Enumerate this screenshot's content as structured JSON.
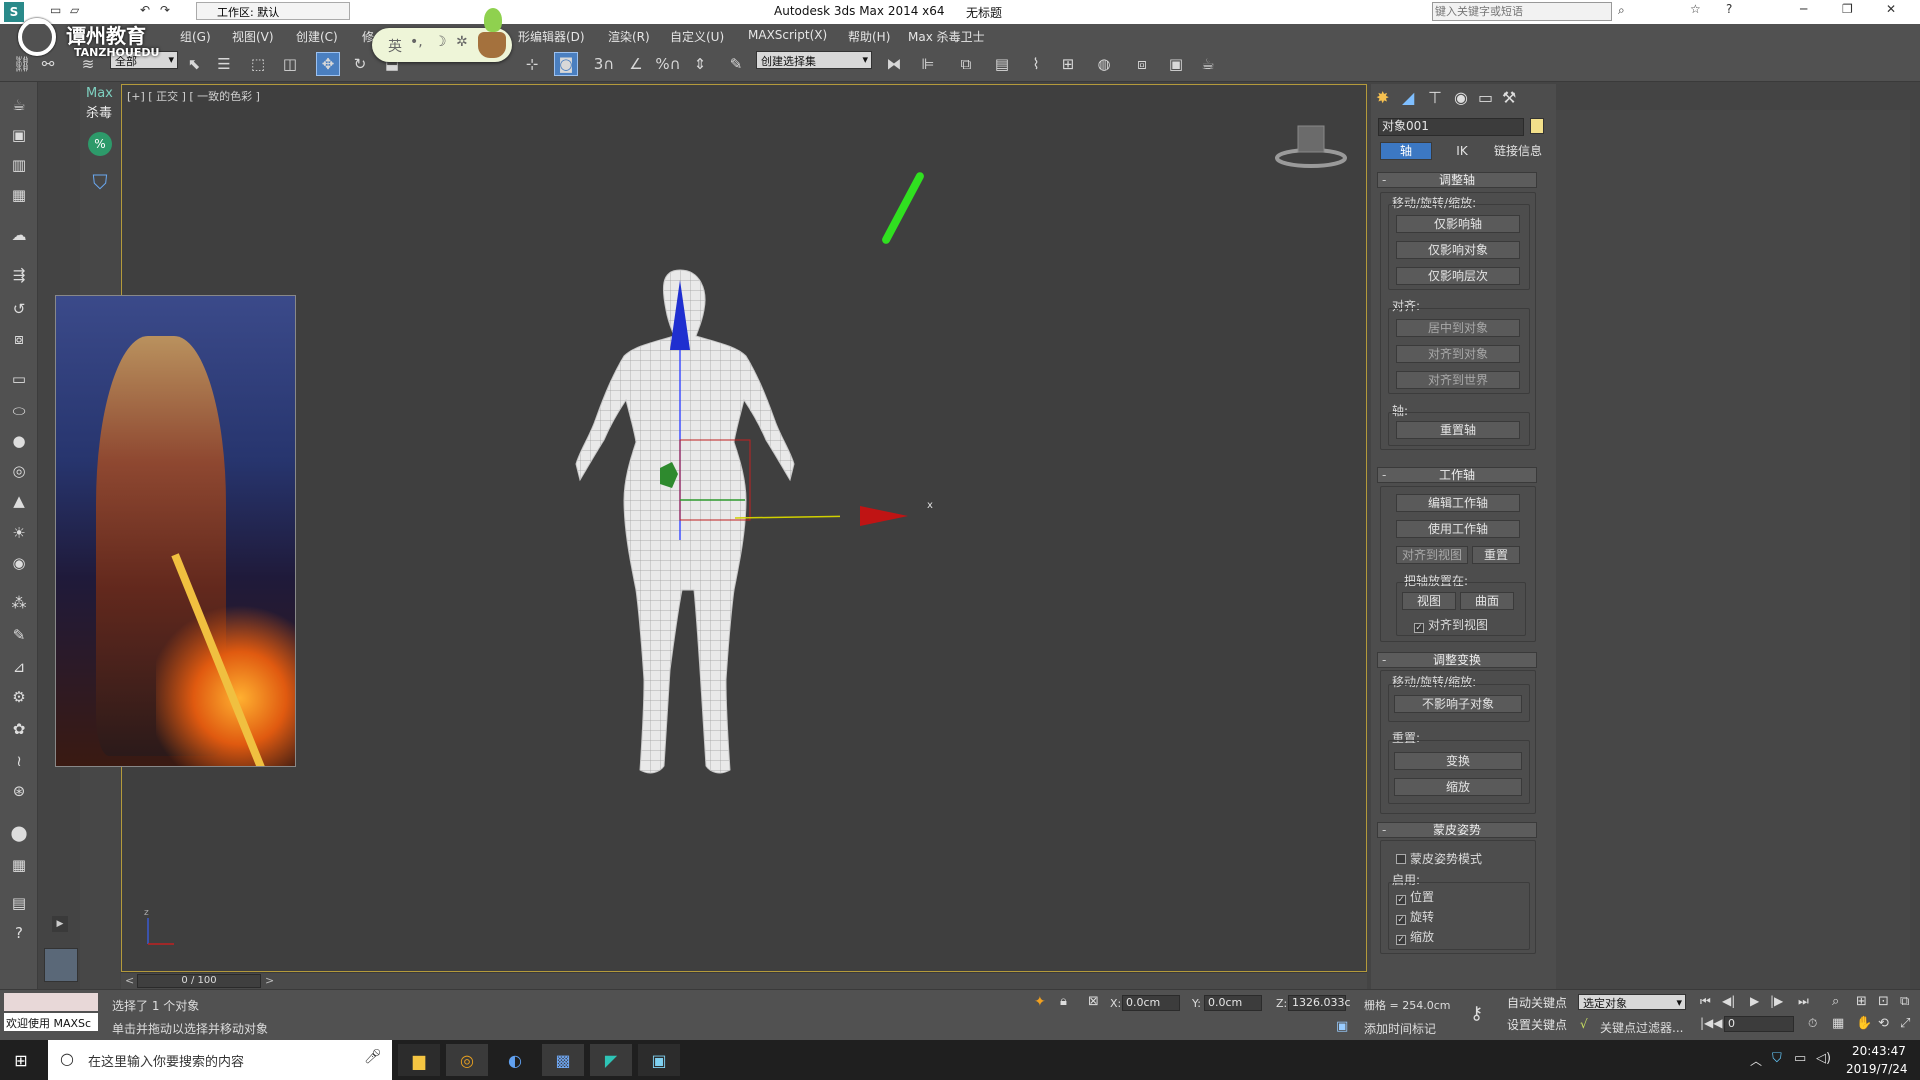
{
  "title": {
    "app": "Autodesk 3ds Max  2014 x64",
    "doc": "无标题",
    "workspace": "工作区: 默认",
    "search_placeholder": "键入关键字或短语"
  },
  "watermark": {
    "cn": "谭州教育",
    "en": "TANZHOUEDU"
  },
  "ime": {
    "label": "英"
  },
  "menu": [
    "组(G)",
    "视图(V)",
    "创建(C)",
    "修",
    "形编辑器(D)",
    "渲染(R)",
    "自定义(U)",
    "MAXScript(X)",
    "帮助(H)",
    "Max 杀毒卫士"
  ],
  "toolbar": {
    "filter_value": "全部",
    "selection_set_value": "创建选择集",
    "snap_labels": [
      "3",
      "%"
    ]
  },
  "left_strip": {
    "max": "Max",
    "antivirus": "杀毒"
  },
  "viewport": {
    "label": "[+] [ 正交 ] [ 一致的色彩 ]",
    "axis_x": "x",
    "axis_z": "z"
  },
  "command_panel": {
    "object_name": "对象001",
    "tabs": [
      "轴",
      "IK",
      "链接信息"
    ],
    "adjust_pivot": {
      "title": "调整轴",
      "move_label": "移动/旋转/缩放:",
      "buttons": [
        "仅影响轴",
        "仅影响对象",
        "仅影响层次"
      ],
      "align_label": "对齐:",
      "align_buttons": [
        "居中到对象",
        "对齐到对象",
        "对齐到世界"
      ],
      "pivot_label": "轴:",
      "reset_pivot": "重置轴"
    },
    "working_pivot": {
      "title": "工作轴",
      "edit": "编辑工作轴",
      "use": "使用工作轴",
      "align_view": "对齐到视图",
      "reset": "重置",
      "place_label": "把轴放置在:",
      "view": "视图",
      "surface": "曲面",
      "align_to_view": "对齐到视图"
    },
    "adjust_transform": {
      "title": "调整变换",
      "move_label": "移动/旋转/缩放:",
      "no_affect_children": "不影响子对象",
      "reset_label": "重置:",
      "transform": "变换",
      "scale": "缩放"
    },
    "skin_pose": {
      "title": "蒙皮姿势",
      "mode": "蒙皮姿势模式",
      "enable_label": "启用:",
      "options": [
        "位置",
        "旋转",
        "缩放"
      ]
    }
  },
  "timeline": {
    "frame": "0 / 100"
  },
  "status": {
    "maxscript": "欢迎使用 MAXSc",
    "selected": "选择了 1 个对象",
    "prompt": "单击并拖动以选择并移动对象",
    "x_label": "X:",
    "x_value": "0.0cm",
    "y_label": "Y:",
    "y_value": "0.0cm",
    "z_label": "Z:",
    "z_value": "1326.033c",
    "grid": "栅格 = 254.0cm",
    "add_time_tag": "添加时间标记",
    "auto_key": "自动关键点",
    "set_key": "设置关键点",
    "key_select": "选定对象",
    "key_filter": "关键点过滤器...",
    "frame_field": "0"
  },
  "taskbar": {
    "search": "在这里输入你要搜索的内容",
    "time": "20:43:47",
    "date": "2019/7/24"
  },
  "colors": {
    "viewport_border": "#b49a3b",
    "accent_blue": "#3c78c3",
    "gizmo_red": "#c01414",
    "gizmo_blue": "#1f2fd0",
    "gizmo_green": "#2e9a2e"
  }
}
